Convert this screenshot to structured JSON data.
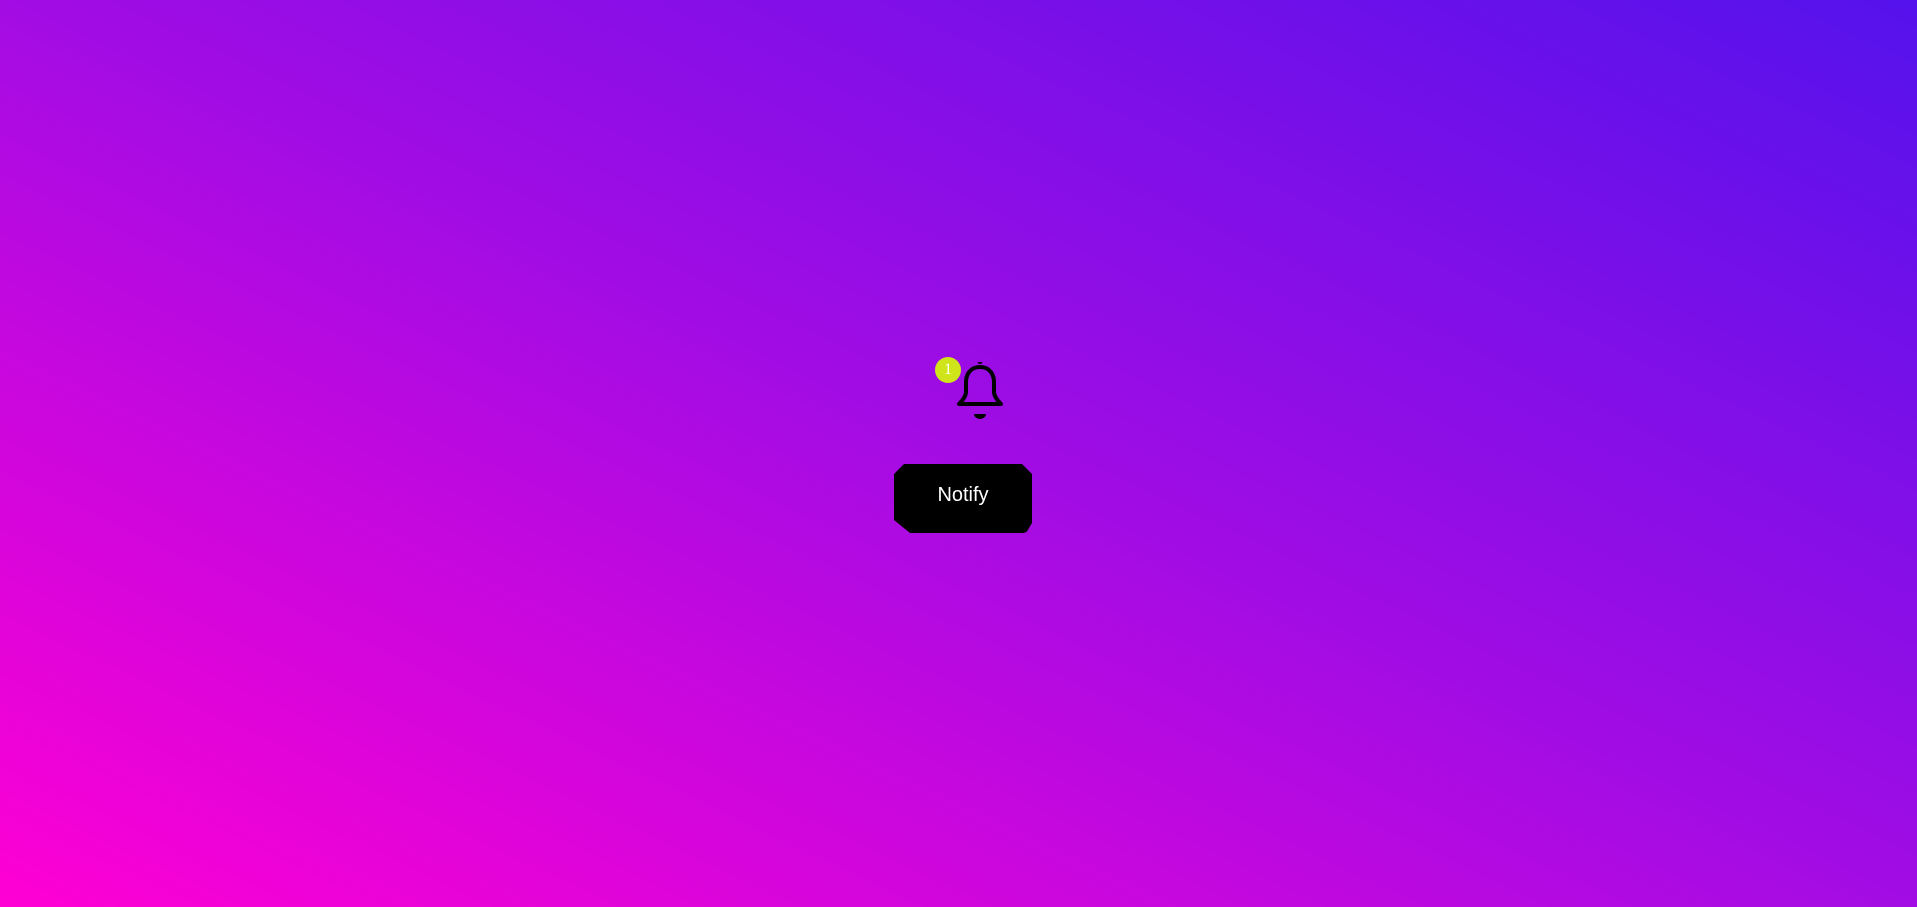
{
  "notification": {
    "badge_count": "1",
    "badge_color": "#cfe51a",
    "icon": "bell-icon"
  },
  "actions": {
    "notify_label": "Notify"
  },
  "theme": {
    "gradient_start": "#ff00d4",
    "gradient_mid": "#a30ce4",
    "gradient_end": "#5512ec",
    "button_bg": "#000000",
    "button_text": "#ffffff"
  }
}
